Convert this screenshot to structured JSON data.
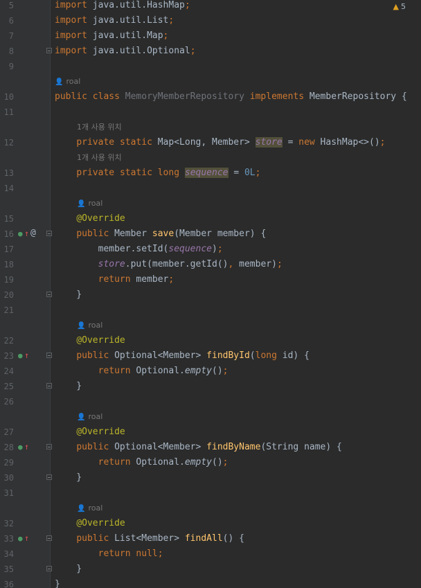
{
  "editor": {
    "warning_indicator": {
      "icon": "warning-triangle-icon",
      "count": "5"
    },
    "inlays": {
      "author": "roal",
      "usage_hint": "1개 사용 위치"
    },
    "lines": [
      {
        "number": "5",
        "code": "import java.util.HashMap;"
      },
      {
        "number": "6",
        "code": "import java.util.List;"
      },
      {
        "number": "7",
        "code": "import java.util.Map;"
      },
      {
        "number": "8",
        "code": "import java.util.Optional;"
      },
      {
        "number": "9",
        "code": ""
      },
      {
        "number": "10",
        "code": "public class MemoryMemberRepository implements MemberRepository {"
      },
      {
        "number": "11",
        "code": ""
      },
      {
        "number": "12",
        "code": "    private static Map<Long, Member> store = new HashMap<>();"
      },
      {
        "number": "13",
        "code": "    private static long sequence = 0L;"
      },
      {
        "number": "14",
        "code": ""
      },
      {
        "number": "15",
        "code": "    @Override"
      },
      {
        "number": "16",
        "code": "    public Member save(Member member) {"
      },
      {
        "number": "17",
        "code": "        member.setId(sequence);"
      },
      {
        "number": "18",
        "code": "        store.put(member.getId(), member);"
      },
      {
        "number": "19",
        "code": "        return member;"
      },
      {
        "number": "20",
        "code": "    }"
      },
      {
        "number": "21",
        "code": ""
      },
      {
        "number": "22",
        "code": "    @Override"
      },
      {
        "number": "23",
        "code": "    public Optional<Member> findById(long id) {"
      },
      {
        "number": "24",
        "code": "        return Optional.empty();"
      },
      {
        "number": "25",
        "code": "    }"
      },
      {
        "number": "26",
        "code": ""
      },
      {
        "number": "27",
        "code": "    @Override"
      },
      {
        "number": "28",
        "code": "    public Optional<Member> findByName(String name) {"
      },
      {
        "number": "29",
        "code": "        return Optional.empty();"
      },
      {
        "number": "30",
        "code": "    }"
      },
      {
        "number": "31",
        "code": ""
      },
      {
        "number": "32",
        "code": "    @Override"
      },
      {
        "number": "33",
        "code": "    public List<Member> findAll() {"
      },
      {
        "number": "34",
        "code": "        return null;"
      },
      {
        "number": "35",
        "code": "    }"
      },
      {
        "number": "36",
        "code": "}"
      }
    ],
    "tokens": {
      "import": "import",
      "public": "public",
      "class": "class",
      "implements": "implements",
      "private": "private",
      "static": "static",
      "long": "long",
      "new": "new",
      "return": "return",
      "null": "null",
      "override": "@Override",
      "pkg_hashmap": "java.util.HashMap",
      "pkg_list": "java.util.List",
      "pkg_map": "java.util.Map",
      "pkg_optional": "java.util.Optional",
      "class_name": "MemoryMemberRepository",
      "interface_name": "MemberRepository",
      "store": "store",
      "sequence": "sequence",
      "zero_long": "0L",
      "save": "save",
      "findById": "findById",
      "findByName": "findByName",
      "findAll": "findAll",
      "empty": "empty"
    }
  },
  "colors": {
    "background": "#2b2b2b",
    "gutter": "#313335",
    "keyword": "#cc7832",
    "method": "#ffc66d",
    "annotation": "#bbb529",
    "static_field": "#9876aa",
    "number": "#6897bb"
  }
}
